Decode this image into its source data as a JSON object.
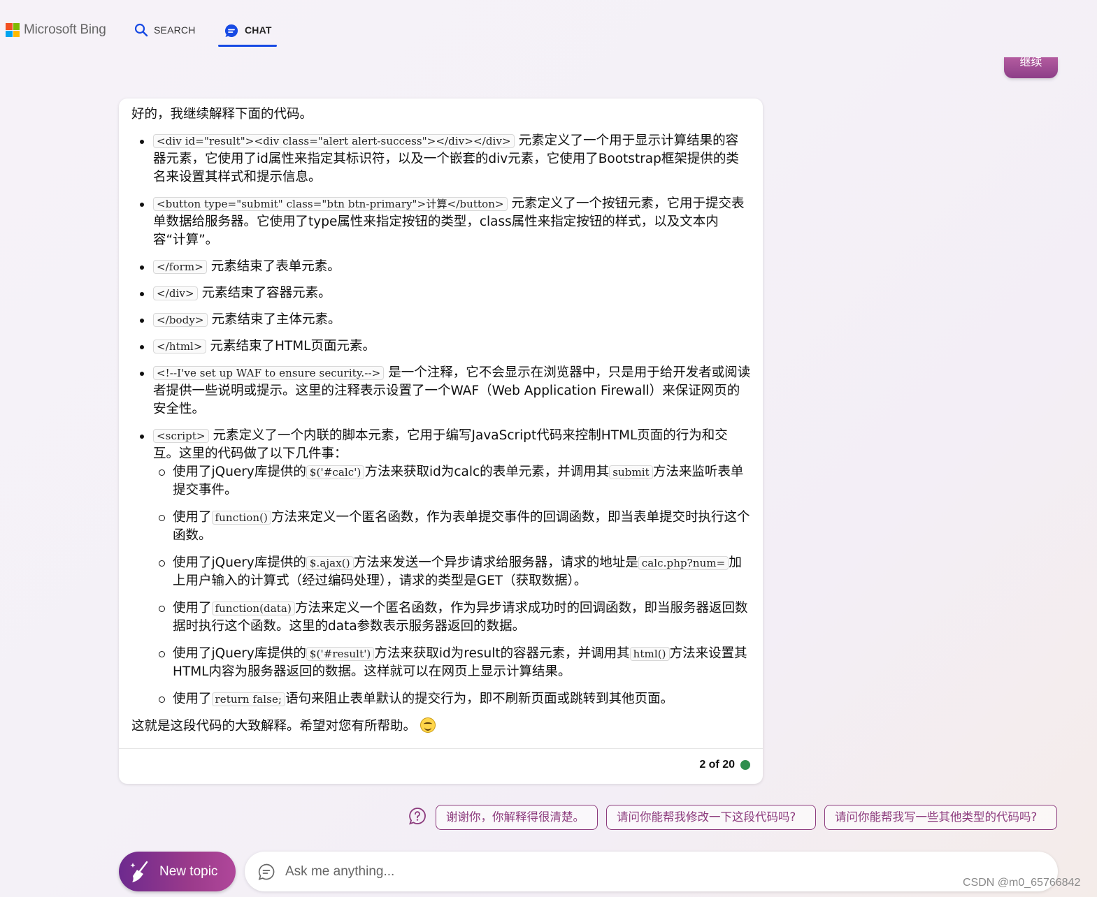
{
  "header": {
    "logo_text": "Microsoft Bing",
    "tabs": [
      {
        "label": "SEARCH",
        "icon": "search-icon"
      },
      {
        "label": "CHAT",
        "icon": "chat-icon",
        "active": true
      }
    ],
    "continue_label": "继续"
  },
  "message": {
    "intro": "好的，我继续解释下面的代码。",
    "items": [
      {
        "code": "<div id=\"result\"><div class=\"alert alert-success\"></div></div>",
        "text": "元素定义了一个用于显示计算结果的容器元素，它使用了id属性来指定其标识符，以及一个嵌套的div元素，它使用了Bootstrap框架提供的类名来设置其样式和提示信息。"
      },
      {
        "code": "<button type=\"submit\" class=\"btn btn-primary\">计算</button>",
        "text": "元素定义了一个按钮元素，它用于提交表单数据给服务器。它使用了type属性来指定按钮的类型，class属性来指定按钮的样式，以及文本内容“计算”。"
      },
      {
        "code": "</form>",
        "text": "元素结束了表单元素。"
      },
      {
        "code": "</div>",
        "text": "元素结束了容器元素。"
      },
      {
        "code": "</body>",
        "text": "元素结束了主体元素。"
      },
      {
        "code": "</html>",
        "text": "元素结束了HTML页面元素。"
      },
      {
        "code": "<!--I've set up WAF to ensure security.-->",
        "text": "是一个注释，它不会显示在浏览器中，只是用于给开发者或阅读者提供一些说明或提示。这里的注释表示设置了一个WAF（Web Application Firewall）来保证网页的安全性。"
      },
      {
        "code": "<script>",
        "text": "元素定义了一个内联的脚本元素，它用于编写JavaScript代码来控制HTML页面的行为和交互。这里的代码做了以下几件事："
      }
    ],
    "sub_items": [
      {
        "pre": "使用了jQuery库提供的",
        "code1": "$('#calc')",
        "mid": "方法来获取id为calc的表单元素，并调用其",
        "code2": "submit",
        "post": "方法来监听表单提交事件。"
      },
      {
        "pre": "使用了",
        "code1": "function()",
        "mid": "方法来定义一个匿名函数，作为表单提交事件的回调函数，即当表单提交时执行这个函数。",
        "code2": "",
        "post": ""
      },
      {
        "pre": "使用了jQuery库提供的",
        "code1": "$.ajax()",
        "mid": "方法来发送一个异步请求给服务器，请求的地址是",
        "code2": "calc.php?num=",
        "post": "加上用户输入的计算式（经过编码处理），请求的类型是GET（获取数据）。"
      },
      {
        "pre": "使用了",
        "code1": "function(data)",
        "mid": "方法来定义一个匿名函数，作为异步请求成功时的回调函数，即当服务器返回数据时执行这个函数。这里的data参数表示服务器返回的数据。",
        "code2": "",
        "post": ""
      },
      {
        "pre": "使用了jQuery库提供的",
        "code1": "$('#result')",
        "mid": "方法来获取id为result的容器元素，并调用其",
        "code2": "html()",
        "post": "方法来设置其HTML内容为服务器返回的数据。这样就可以在网页上显示计算结果。"
      },
      {
        "pre": "使用了",
        "code1": "return false;",
        "mid": "语句来阻止表单默认的提交行为，即不刷新页面或跳转到其他页面。",
        "code2": "",
        "post": ""
      }
    ],
    "outro": "这就是这段代码的大致解释。希望对您有所帮助。",
    "counter": "2 of 20",
    "status_color": "#2f8f4e"
  },
  "suggestions": [
    "谢谢你，你解释得很清楚。",
    "请问你能帮我修改一下这段代码吗?",
    "请问你能帮我写一些其他类型的代码吗?"
  ],
  "bottom": {
    "new_topic_label": "New topic",
    "ask_placeholder": "Ask me anything...",
    "watermark": "CSDN @m0_65766842"
  },
  "colors": {
    "accent_blue": "#174ae4",
    "accent_purple": "#8c3b7d"
  }
}
